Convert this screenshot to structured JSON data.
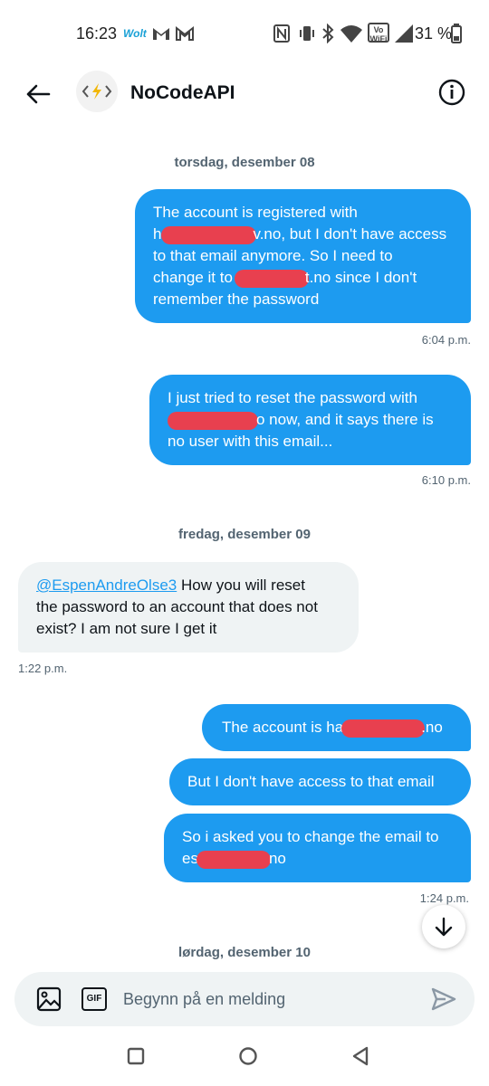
{
  "status_bar": {
    "time": "16:23",
    "battery_pct": "31 %",
    "app_badge": "Wolt",
    "wifi_badge_top": "Vo",
    "wifi_badge_bottom": "WiFi"
  },
  "header": {
    "title": "NoCodeAPI",
    "avatar_glyph": "<⚡>"
  },
  "dates": {
    "d1": "torsdag, desember 08",
    "d2": "fredag, desember 09",
    "d3": "lørdag, desember 10"
  },
  "messages": {
    "m1": {
      "l1": "The account is registered with",
      "l2a": "h",
      "l2b": "v.no, but I don't have access",
      "l3": "to that email anymore. So I need to",
      "l4a": "change it to",
      "l4b": "t.no since I don't",
      "l5": "remember the password",
      "time": "6:04 p.m."
    },
    "m2": {
      "l1": "I just tried to reset the password with",
      "l2b": "o now, and it says there is",
      "l3": "no user with this email...",
      "time": "6:10 p.m."
    },
    "m3": {
      "mention": "@EspenAndreOlse3",
      "l1": " How you will reset",
      "l2": "the password to an account that does not",
      "l3": "exist? I am not sure I get it",
      "time": "1:22 p.m."
    },
    "m4": {
      "a": "The account is ha",
      "b": ".no"
    },
    "m5": {
      "text": "But I don't have access to that email"
    },
    "m6": {
      "l1": "So i asked you to change the email to",
      "l2a": "es",
      "l2b": "no",
      "time": "1:24 p.m."
    }
  },
  "composer": {
    "placeholder": "Begynn på en melding",
    "gif_label": "GIF"
  }
}
